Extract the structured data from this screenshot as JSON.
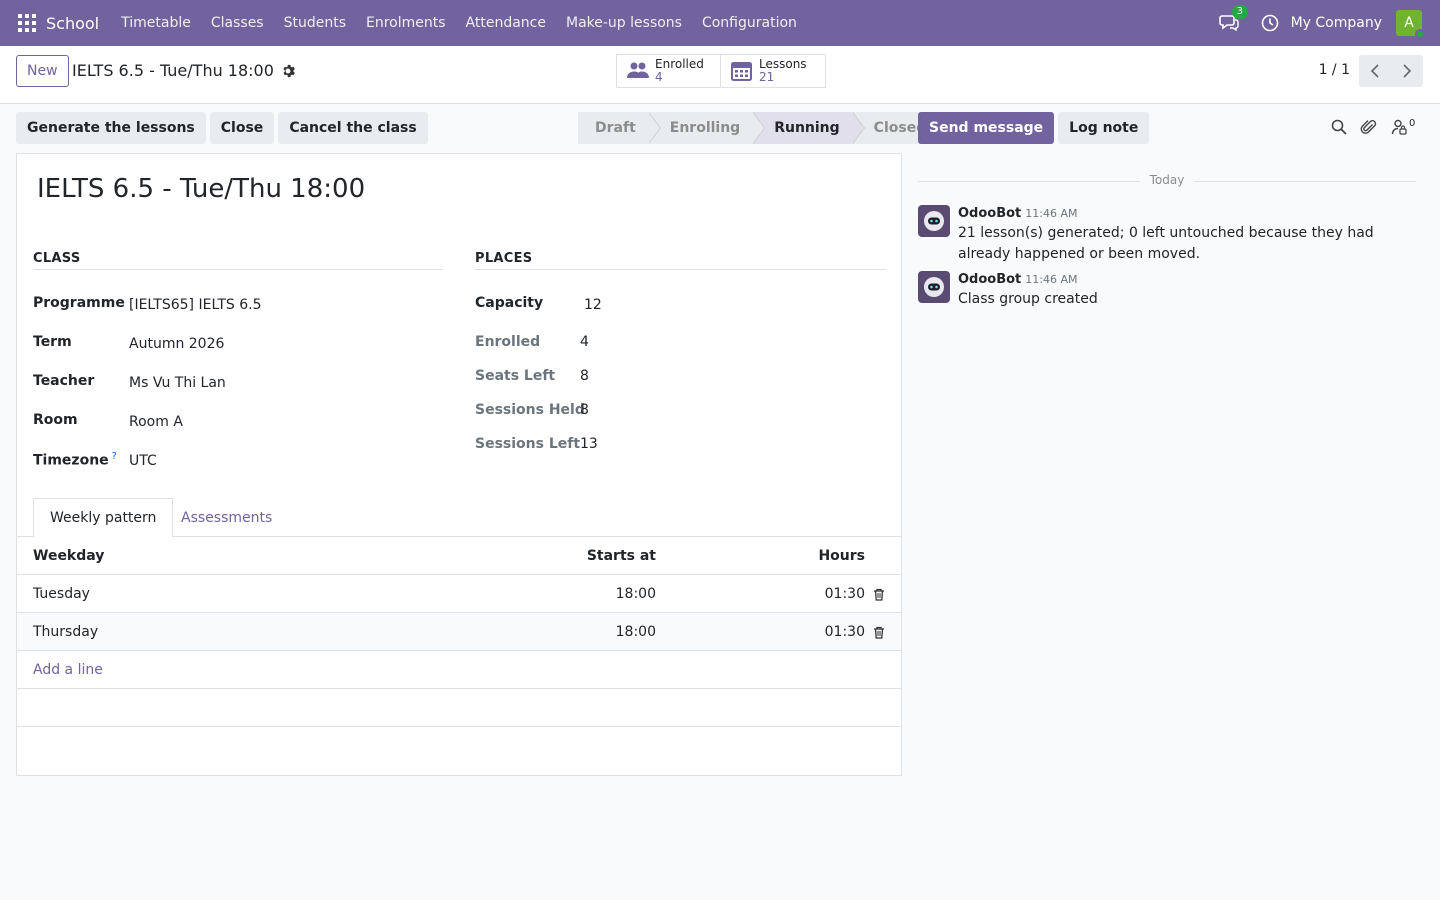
{
  "navbar": {
    "app_name": "School",
    "menu": [
      "Timetable",
      "Classes",
      "Students",
      "Enrolments",
      "Attendance",
      "Make-up lessons",
      "Configuration"
    ],
    "chat_badge": "3",
    "company": "My Company",
    "avatar_letter": "A",
    "bg_color": "#71639e"
  },
  "control": {
    "new_label": "New",
    "record_title": "IELTS 6.5 - Tue/Thu 18:00",
    "stats": [
      {
        "label": "Enrolled",
        "value": "4",
        "icon": "users-icon"
      },
      {
        "label": "Lessons",
        "value": "21",
        "icon": "calendar-icon"
      }
    ],
    "pager": "1 / 1"
  },
  "actions": {
    "generate": "Generate the lessons",
    "close": "Close",
    "cancel": "Cancel the class"
  },
  "status": {
    "stages": [
      "Draft",
      "Enrolling",
      "Running",
      "Closed"
    ],
    "current": "Running"
  },
  "form": {
    "title": "IELTS 6.5 - Tue/Thu 18:00",
    "class_group": {
      "heading": "CLASS",
      "fields": [
        {
          "label": "Programme",
          "value": "[IELTS65] IELTS 6.5"
        },
        {
          "label": "Term",
          "value": "Autumn 2026"
        },
        {
          "label": "Teacher",
          "value": "Ms Vu Thi Lan"
        },
        {
          "label": "Room",
          "value": "Room A"
        },
        {
          "label": "Timezone",
          "value": "UTC",
          "help": "?"
        }
      ]
    },
    "places_group": {
      "heading": "PLACES",
      "fields": [
        {
          "label": "Capacity",
          "value": "12"
        },
        {
          "label": "Enrolled",
          "value": "4"
        },
        {
          "label": "Seats Left",
          "value": "8"
        },
        {
          "label": "Sessions Held",
          "value": "8"
        },
        {
          "label": "Sessions Left",
          "value": "13"
        }
      ]
    },
    "tabs": [
      "Weekly pattern",
      "Assessments"
    ],
    "table": {
      "columns": [
        "Weekday",
        "Starts at",
        "Hours"
      ],
      "rows": [
        {
          "weekday": "Tuesday",
          "starts": "18:00",
          "hours": "01:30"
        },
        {
          "weekday": "Thursday",
          "starts": "18:00",
          "hours": "01:30"
        }
      ],
      "add_line": "Add a line"
    }
  },
  "chatter": {
    "send_message": "Send message",
    "log_note": "Log note",
    "followers_count": "0",
    "separator": "Today",
    "messages": [
      {
        "author": "OdooBot",
        "time": "11:46 AM",
        "text": "21 lesson(s) generated; 0 left untouched because they had already happened or been moved."
      },
      {
        "author": "OdooBot",
        "time": "11:46 AM",
        "text": "Class group created"
      }
    ]
  }
}
